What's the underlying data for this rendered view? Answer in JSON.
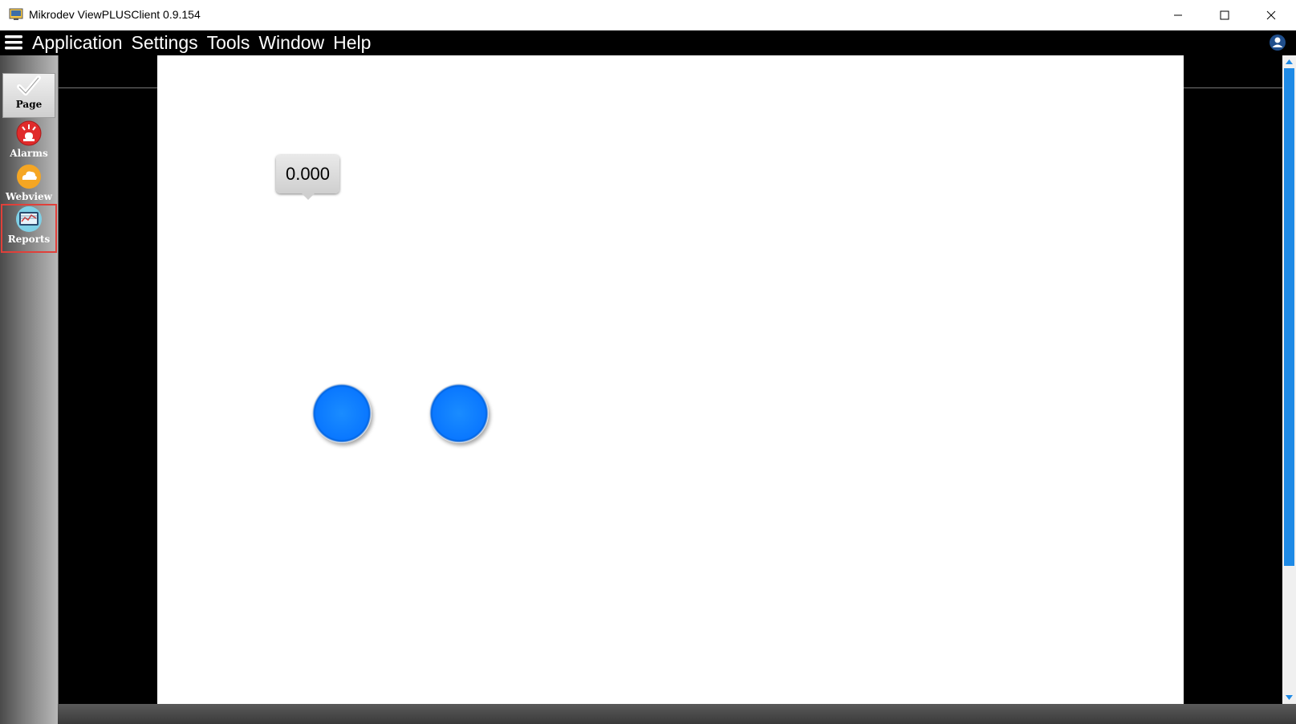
{
  "window": {
    "title": "Mikrodev ViewPLUSClient 0.9.154"
  },
  "menubar": {
    "items": [
      "Application",
      "Settings",
      "Tools",
      "Window",
      "Help"
    ]
  },
  "sidebar": {
    "items": [
      {
        "label": "Page",
        "icon": "checkmark-icon"
      },
      {
        "label": "Alarms",
        "icon": "alarm-siren-icon"
      },
      {
        "label": "Webview",
        "icon": "cloud-icon"
      },
      {
        "label": "Reports",
        "icon": "report-chart-icon"
      }
    ]
  },
  "canvas": {
    "value_display": "0.000",
    "indicator_color": "#0a78ff"
  },
  "colors": {
    "accent": "#1e8ae6",
    "highlight": "#e0403a"
  }
}
